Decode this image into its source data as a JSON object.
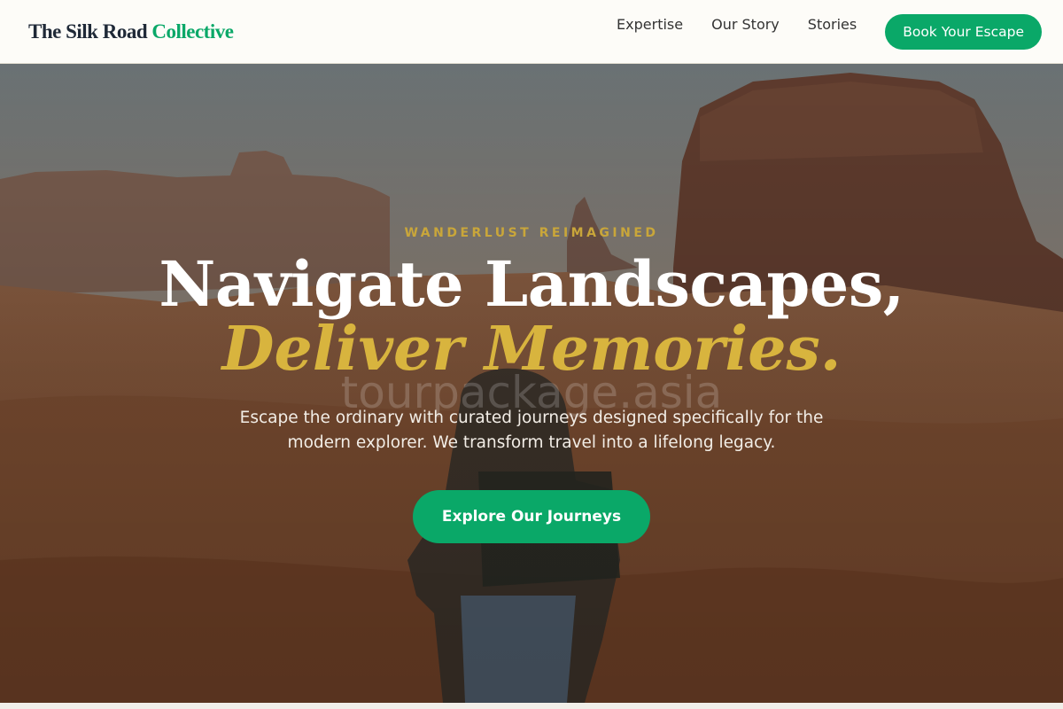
{
  "header": {
    "logo_main": "The Silk Road",
    "logo_accent": "Collective",
    "nav": [
      {
        "label": "Expertise"
      },
      {
        "label": "Our Story"
      },
      {
        "label": "Stories"
      }
    ],
    "cta_label": "Book Your Escape"
  },
  "hero": {
    "eyebrow": "WANDERLUST REIMAGINED",
    "headline_line1": "Navigate Landscapes,",
    "headline_line2": "Deliver Memories.",
    "watermark": "tourpackage.asia",
    "subtitle": "Escape the ordinary with curated journeys designed specifically for the modern explorer. We transform travel into a lifelong legacy.",
    "cta_label": "Explore Our Journeys"
  },
  "colors": {
    "brand_green": "#0aa868",
    "gold_accent": "#d8b43e",
    "eyebrow_gold": "#c9a63a",
    "header_bg": "#fdfcf8",
    "text_dark": "#1f2937"
  }
}
